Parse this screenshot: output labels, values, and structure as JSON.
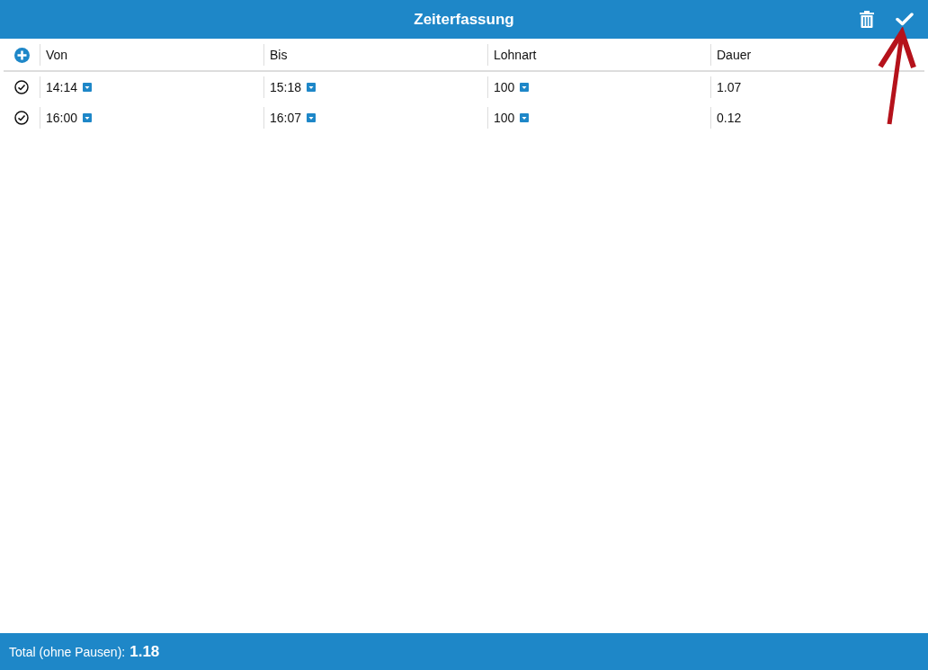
{
  "header": {
    "title": "Zeiterfassung"
  },
  "table": {
    "columns": [
      "Von",
      "Bis",
      "Lohnart",
      "Dauer"
    ],
    "rows": [
      {
        "von": "14:14",
        "bis": "15:18",
        "lohnart": "100",
        "dauer": "1.07"
      },
      {
        "von": "16:00",
        "bis": "16:07",
        "lohnart": "100",
        "dauer": "0.12"
      }
    ]
  },
  "footer": {
    "label": "Total (ohne Pausen):",
    "value": "1.18"
  }
}
